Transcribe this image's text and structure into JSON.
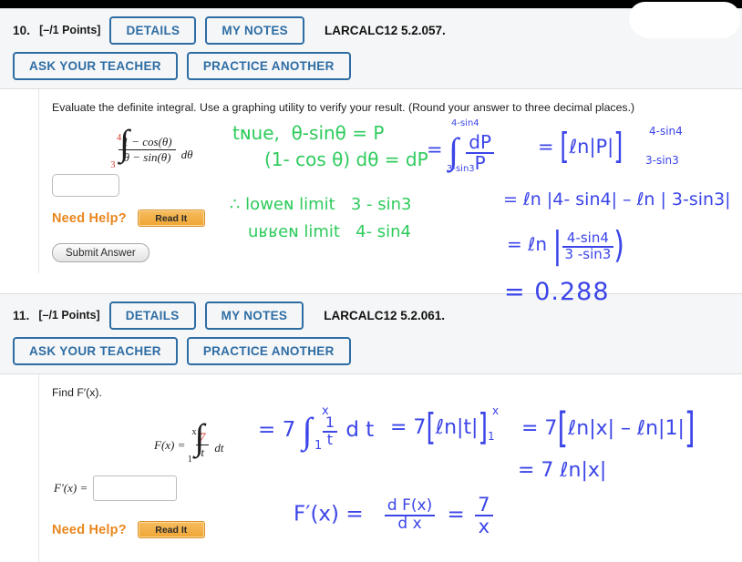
{
  "window": {
    "background": "#ffffff",
    "topbar_color": "#000000",
    "accent_blue": "#2e6da4",
    "need_help_orange": "#e8861e",
    "ink_green": "#2ecb5c",
    "ink_blue": "#3b45e8"
  },
  "questions": [
    {
      "number": "10.",
      "points": "[–/1 Points]",
      "details_label": "DETAILS",
      "my_notes_label": "MY NOTES",
      "code": "LARCALC12 5.2.057.",
      "ask_teacher_label": "ASK YOUR TEACHER",
      "practice_another_label": "PRACTICE ANOTHER",
      "prompt": "Evaluate the definite integral. Use a graphing utility to verify your result. (Round your answer to three decimal places.)",
      "integral": {
        "upper": "4",
        "lower": "3",
        "numerator": "1 − cos(θ)",
        "denominator": "θ − sin(θ)",
        "differential": "dθ"
      },
      "answer_value": "",
      "need_help_label": "Need Help?",
      "read_it_label": "Read It",
      "submit_label": "Submit Answer"
    },
    {
      "number": "11.",
      "points": "[–/1 Points]",
      "details_label": "DETAILS",
      "my_notes_label": "MY NOTES",
      "code": "LARCALC12 5.2.061.",
      "ask_teacher_label": "ASK YOUR TEACHER",
      "practice_another_label": "PRACTICE ANOTHER",
      "prompt": "Find F′(x).",
      "formula": {
        "lhs": "F(x) =",
        "upper": "x",
        "lower": "1",
        "numerator": "7",
        "denominator": "t",
        "differential": "dt"
      },
      "answer_label": "F′(x) =",
      "answer_value": "",
      "need_help_label": "Need Help?",
      "read_it_label": "Read It"
    }
  ],
  "annotations": {
    "q10": [
      {
        "id": "a1",
        "color": "green",
        "text": "tɴue,  θ - sinθ = P"
      },
      {
        "id": "a2",
        "color": "green",
        "text": "(1- cos θ) dθ = dP"
      },
      {
        "id": "a3",
        "color": "green",
        "text": "∴ lower limit   3 - sin3"
      },
      {
        "id": "a4",
        "color": "green",
        "text": "upper limit   4 - sin4"
      },
      {
        "id": "a5",
        "color": "blue",
        "text": "=  ∫ dP / P",
        "upper": "4 - sin4",
        "lower": "3 - sin3"
      },
      {
        "id": "a6",
        "color": "blue",
        "text": "= [ ln|P| ]",
        "upper": "4 - sin4",
        "lower": "3 - sin3"
      },
      {
        "id": "a7",
        "color": "blue",
        "text": "= ln |4 - sin4| − ln |3 - sin3|"
      },
      {
        "id": "a8",
        "color": "blue",
        "text": "= ln | (4 - sin4) / (3 - sin3) |"
      },
      {
        "id": "a9",
        "color": "blue",
        "text": "= 0.288"
      }
    ],
    "q11": [
      {
        "id": "b1",
        "color": "blue",
        "text": "= 7 ∫ (1/t) dt",
        "upper": "x",
        "lower": "1"
      },
      {
        "id": "b2",
        "color": "blue",
        "text": "= 7 [ ln|t| ]",
        "upper": "x",
        "lower": "1"
      },
      {
        "id": "b3",
        "color": "blue",
        "text": "= 7 [ ln|x| − ln|1| ]"
      },
      {
        "id": "b4",
        "color": "blue",
        "text": "= 7 ln|x|"
      },
      {
        "id": "b5",
        "color": "blue",
        "text": "F′(x) =   dF(x)/dx  =  7/x"
      }
    ]
  }
}
